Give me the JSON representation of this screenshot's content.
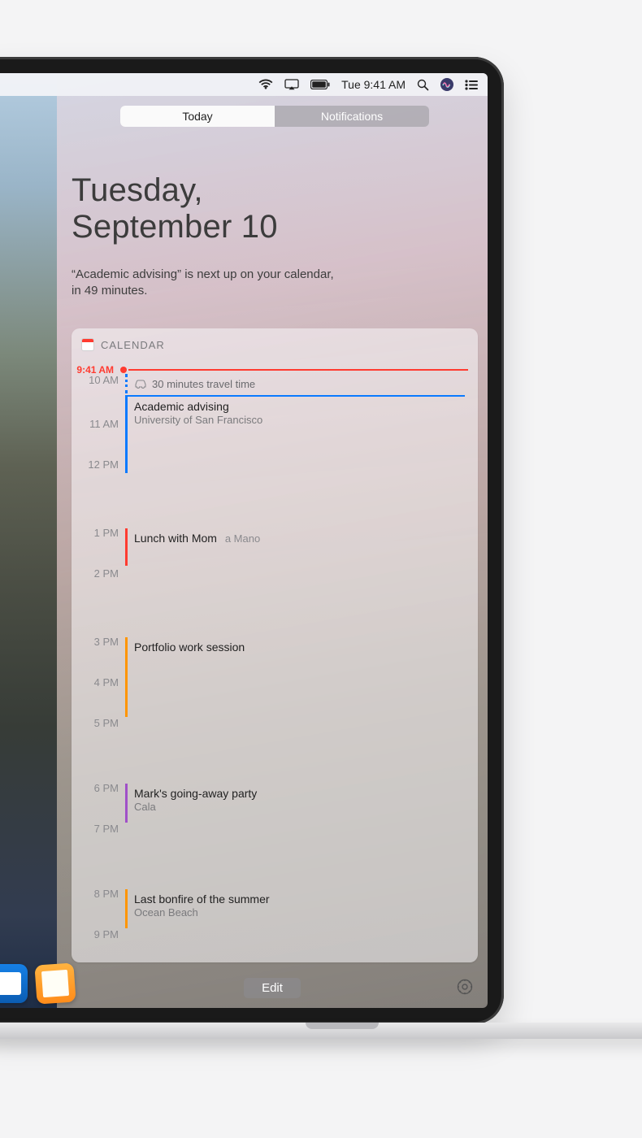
{
  "menubar": {
    "time": "Tue 9:41 AM"
  },
  "tabs": {
    "today": "Today",
    "notifications": "Notifications",
    "active": "today"
  },
  "header": {
    "line1": "Tuesday,",
    "line2": "September 10",
    "summary": "“Academic advising” is next up on your calendar, in 49 minutes."
  },
  "widget": {
    "title": "CALENDAR"
  },
  "now": {
    "label": "9:41 AM"
  },
  "hours": [
    "10 AM",
    "11 AM",
    "12 PM",
    "1 PM",
    "2 PM",
    "3 PM",
    "4 PM",
    "5 PM",
    "6 PM",
    "7 PM",
    "8 PM",
    "9 PM"
  ],
  "travel": {
    "text": "30 minutes travel time",
    "color": "#0a7aff"
  },
  "events": [
    {
      "title": "Academic advising",
      "sub": "University of San Francisco",
      "color": "#0a7aff"
    },
    {
      "title": "Lunch with Mom",
      "loc": "a Mano",
      "color": "#ff3b30"
    },
    {
      "title": "Portfolio work session",
      "color": "#ff9500"
    },
    {
      "title": "Mark's going-away party",
      "sub": "Cala",
      "color": "#a050c8"
    },
    {
      "title": "Last bonfire of the summer",
      "sub": "Ocean Beach",
      "color": "#ff9500"
    }
  ],
  "footer": {
    "edit": "Edit"
  },
  "dock": {
    "app1": "keynote",
    "app2": "pages"
  }
}
